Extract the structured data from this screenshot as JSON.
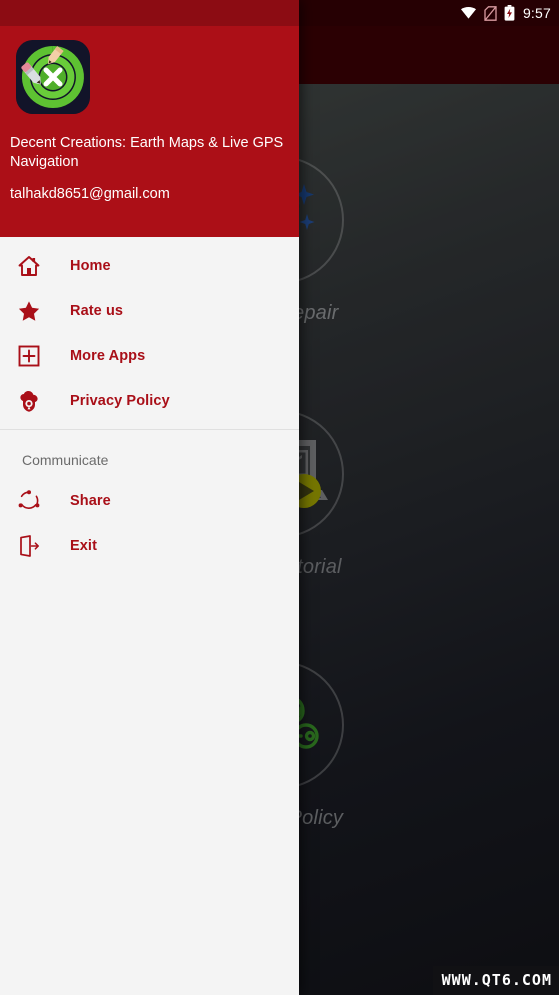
{
  "statusbar": {
    "time": "9:57",
    "icons": [
      "wifi-icon",
      "no-sim-icon",
      "battery-charging-icon"
    ]
  },
  "drawer": {
    "header": {
      "app_logo": "app-logo-icon",
      "app_name": "Decent Creations: Earth Maps & Live GPS Navigation",
      "email": "talhakd8651@gmail.com",
      "background_color": "#ac0f17"
    },
    "menu_primary": [
      {
        "icon": "home-icon",
        "label": "Home"
      },
      {
        "icon": "star-icon",
        "label": "Rate us"
      },
      {
        "icon": "plus-square-icon",
        "label": "More Apps"
      },
      {
        "icon": "privacy-shield-icon",
        "label": "Privacy Policy"
      }
    ],
    "group_title": "Communicate",
    "menu_secondary": [
      {
        "icon": "share-icon",
        "label": "Share"
      },
      {
        "icon": "exit-icon",
        "label": "Exit"
      }
    ],
    "accent_color": "#a90f18",
    "surface_color": "#f4f4f4"
  },
  "main": {
    "toolbar_color": "#420105",
    "tiles": [
      {
        "icon": "magic-wand-icon",
        "label": "Quick Repair"
      },
      {
        "icon": "video-tutorial-icon",
        "label": "Video Tutorial"
      },
      {
        "icon": "cloud-key-shield-icon",
        "label": "Privacy Policy"
      }
    ]
  },
  "watermark": {
    "text": "WWW.QT6.COM"
  }
}
